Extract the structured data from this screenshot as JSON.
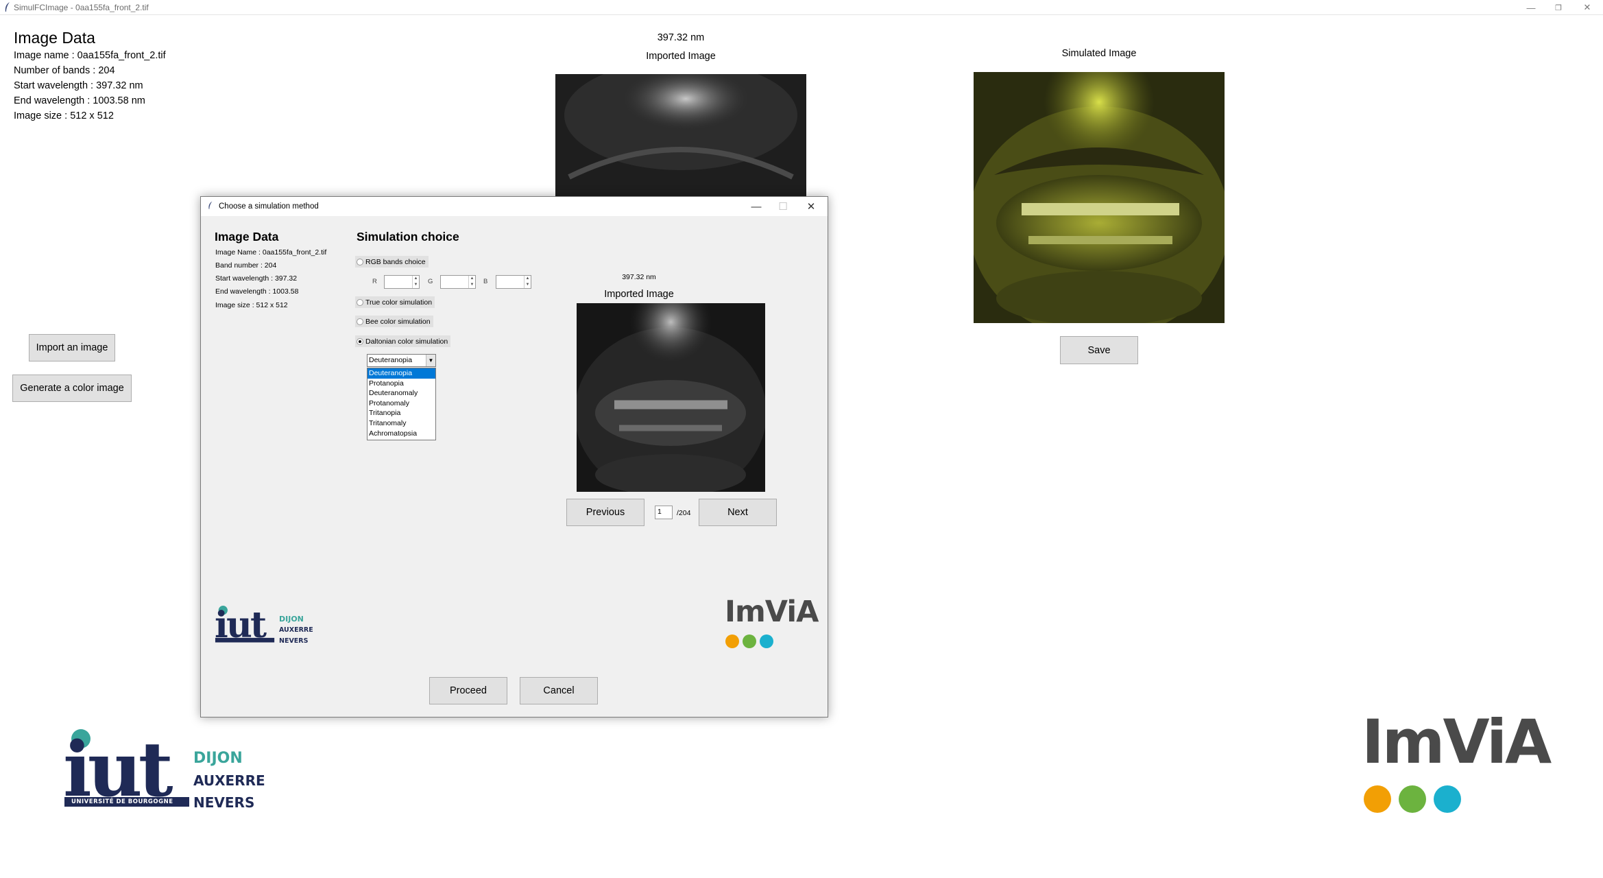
{
  "window": {
    "title": "SimulFCImage - 0aa155fa_front_2.tif",
    "min": "—",
    "restore": "❐",
    "close": "✕"
  },
  "image_data": {
    "title": "Image Data",
    "name": "Image name : 0aa155fa_front_2.tif",
    "bands": "Number of bands : 204",
    "start": "Start wavelength : 397.32 nm",
    "end": "End wavelength : 1003.58 nm",
    "size": "Image size : 512 x 512"
  },
  "buttons": {
    "import": "Import an image",
    "generate": "Generate a color image",
    "save": "Save"
  },
  "imported": {
    "wavelength": "397.32 nm",
    "caption": "Imported Image"
  },
  "simulated": {
    "caption": "Simulated Image"
  },
  "dialog": {
    "title": "Choose a simulation method",
    "min": "—",
    "max": "☐",
    "close": "✕",
    "info": {
      "title": "Image Data",
      "name": "Image Name : 0aa155fa_front_2.tif",
      "bands": "Band number : 204",
      "start": "Start wavelength : 397.32",
      "end": "End wavelength : 1003.58",
      "size": "Image size : 512 x 512"
    },
    "sim_title": "Simulation choice",
    "options": {
      "rgb": "RGB bands choice",
      "true_color": "True color simulation",
      "bee": "Bee color simulation",
      "daltonian": "Daltonian color simulation"
    },
    "selected_option": "daltonian",
    "rgb_labels": {
      "r": "R",
      "g": "G",
      "b": "B"
    },
    "combo_value": "Deuteranopia",
    "dropdown_options": [
      "Deuteranopia",
      "Protanopia",
      "Deuteranomaly",
      "Protanomaly",
      "Tritanopia",
      "Tritanomaly",
      "Achromatopsia"
    ],
    "dropdown_selected": "Deuteranopia",
    "preview": {
      "wavelength": "397.32 nm",
      "caption": "Imported Image"
    },
    "nav": {
      "previous": "Previous",
      "next": "Next",
      "page": "1",
      "total": "/204"
    },
    "proceed": "Proceed",
    "cancel": "Cancel"
  },
  "logos": {
    "iut": {
      "mark": "iut",
      "dijon": "DIJON",
      "auxerre": "AUXERRE",
      "nevers": "NEVERS",
      "university": "UNIVERSITÉ DE BOURGOGNE"
    },
    "imvia": {
      "text": "ImViA"
    }
  },
  "colors": {
    "iut_navy": "#1f2a56",
    "iut_teal": "#3aa59b",
    "imvia_orange": "#f29f05",
    "imvia_green": "#6cb33f",
    "imvia_blue": "#1bb0ce",
    "selection": "#0078d7"
  }
}
